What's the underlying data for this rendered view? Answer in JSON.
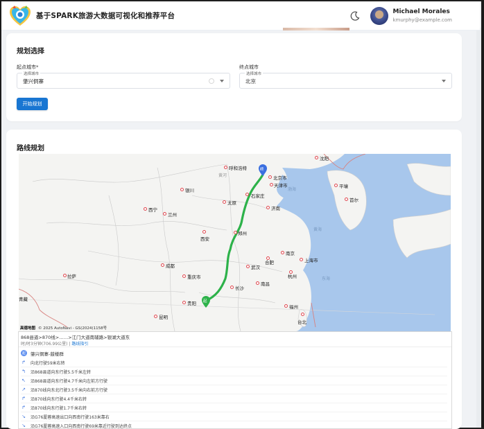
{
  "header": {
    "site_title": "基于SPARK旅游大数据可视化和推荐平台",
    "user_name": "Michael Morales",
    "user_email": "kmurphy@example.com"
  },
  "plan": {
    "title": "规划选择",
    "start_label": "起点城市*",
    "end_label": "终点城市",
    "start_legend": "选择城市",
    "end_legend": "选择城市",
    "start_value": "肇兴侗寨",
    "end_value": "北京",
    "start_button": "开始规划"
  },
  "route": {
    "title": "路线规划",
    "map": {
      "cities": [
        {
          "name": "沈阳"
        },
        {
          "name": "呼和浩特"
        },
        {
          "name": "北京市"
        },
        {
          "name": "天津市"
        },
        {
          "name": "银川"
        },
        {
          "name": "太原"
        },
        {
          "name": "石家庄"
        },
        {
          "name": "平壤"
        },
        {
          "name": "首尔"
        },
        {
          "name": "西宁"
        },
        {
          "name": "兰州"
        },
        {
          "name": "济南"
        },
        {
          "name": "郑州"
        },
        {
          "name": "西安"
        },
        {
          "name": "南京"
        },
        {
          "name": "合肥"
        },
        {
          "name": "上海市"
        },
        {
          "name": "成都"
        },
        {
          "name": "武汉"
        },
        {
          "name": "杭州"
        },
        {
          "name": "重庆市"
        },
        {
          "name": "拉萨"
        },
        {
          "name": "长沙"
        },
        {
          "name": "南昌"
        },
        {
          "name": "贵阳"
        },
        {
          "name": "福州"
        },
        {
          "name": "台北"
        },
        {
          "name": "昆明"
        }
      ],
      "regions": [
        "黄河",
        "渤海",
        "黄海",
        "东海",
        "青藏"
      ],
      "start_marker": "起",
      "end_marker": "终",
      "attribution_brand": "高德地图",
      "attribution_text": "© 2025 AutoNavi - GS(2024)1158号"
    },
    "summary": "868县道>870线>……>江门大道南辅路>银湖大道东",
    "meta_prefix": "时/时3分钟(706.99公里) |",
    "meta_link": "路线指引",
    "segment_icon": "起",
    "segment_title": "肇兴侗寨-鼓楼群",
    "steps": [
      "向北行驶59米右转",
      "沿868县道向东行驶5.5千米左转",
      "沿868县道向东行驶4.7千米向左前方行驶",
      "沿870线向东北行驶3.5千米向右前方行驶",
      "沿870线向东行驶4.4千米右转",
      "沿870线向东行驶1.7千米右转",
      "沿G76厦蓉高速出口向西南行驶163米靠右",
      "沿G76厦蓉高速入口向西南行驶69米靠近行驶到达终点"
    ]
  },
  "colors": {
    "primary": "#1976d2",
    "route_line": "#2db24a",
    "city_dot": "#e0464e",
    "sea": "#a8c7ec"
  }
}
